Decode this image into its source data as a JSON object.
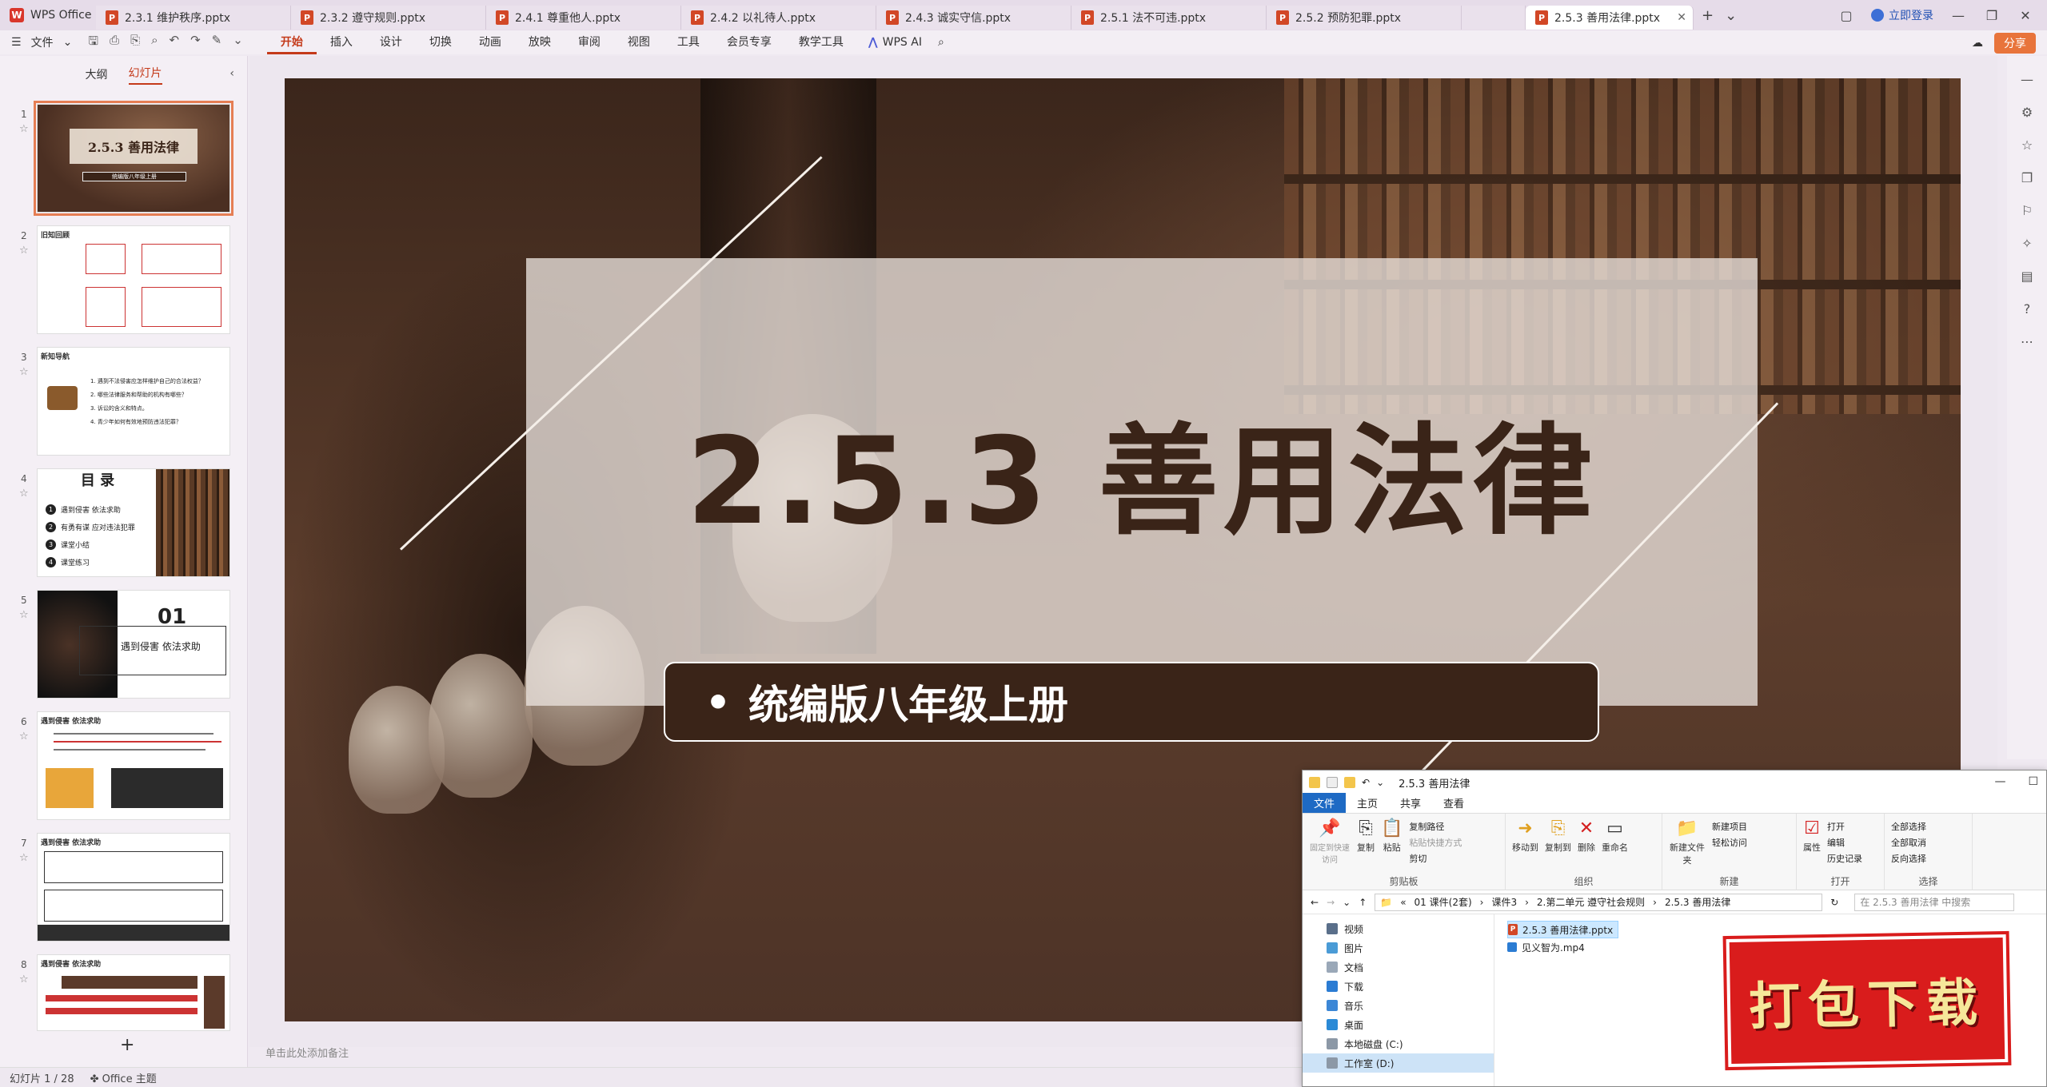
{
  "tabbar": {
    "app_name": "WPS Office",
    "tabs": [
      {
        "label": "2.3.1 维护秩序.pptx"
      },
      {
        "label": "2.3.2 遵守规则.pptx"
      },
      {
        "label": "2.4.1 尊重他人.pptx"
      },
      {
        "label": "2.4.2 以礼待人.pptx"
      },
      {
        "label": "2.4.3 诚实守信.pptx"
      },
      {
        "label": "2.5.1 法不可违.pptx"
      },
      {
        "label": "2.5.2 预防犯罪.pptx"
      },
      {
        "label": ""
      },
      {
        "label": "2.5.3 善用法律.pptx"
      }
    ],
    "login_label": "立即登录"
  },
  "menubar": {
    "file_label": "文件",
    "tabs": [
      "开始",
      "插入",
      "设计",
      "切换",
      "动画",
      "放映",
      "审阅",
      "视图",
      "工具",
      "会员专享",
      "教学工具"
    ],
    "active_tab": "开始",
    "ai_label": "WPS AI",
    "share_label": "分享"
  },
  "leftpanel": {
    "tabs": [
      "大纲",
      "幻灯片"
    ],
    "active_tab": "幻灯片",
    "thumbs": [
      {
        "num": "1",
        "title": "2.5.3 善用法律",
        "subtitle": "统编版八年级上册"
      },
      {
        "num": "2",
        "header": "旧知回顾"
      },
      {
        "num": "3",
        "header": "新知导航",
        "lines": [
          "1. 遇到不法侵害应怎样维护自己的合法权益？",
          "2. 哪些法律服务和帮助的机构有哪些？",
          "3. 诉讼的含义和特点。",
          "4. 青少年如何有效地预防违法犯罪？"
        ]
      },
      {
        "num": "4",
        "title": "目 录",
        "items": [
          "遇到侵害 依法求助",
          "有勇有谋 应对违法犯罪",
          "课堂小结",
          "课堂练习"
        ]
      },
      {
        "num": "5",
        "number": "01",
        "text": "遇到侵害 依法求助"
      },
      {
        "num": "6",
        "header": "遇到侵害 依法求助"
      },
      {
        "num": "7",
        "header": "遇到侵害 依法求助"
      },
      {
        "num": "8",
        "header": "遇到侵害 依法求助"
      }
    ]
  },
  "slide": {
    "title": "2.5.3 善用法律",
    "subtitle": "统编版八年级上册",
    "bullet": "•"
  },
  "notes_placeholder": "单击此处添加备注",
  "statusbar": {
    "slide_count": "幻灯片 1 / 28",
    "theme": "Office 主题"
  },
  "explorer": {
    "title": "2.5.3 善用法律",
    "ribbon_tabs": [
      "文件",
      "主页",
      "共享",
      "查看"
    ],
    "groups": [
      {
        "label": "剪贴板",
        "buttons": [
          "固定到快速访问",
          "复制",
          "粘贴"
        ],
        "small": [
          "复制路径",
          "粘贴快捷方式",
          "剪切"
        ]
      },
      {
        "label": "组织",
        "buttons": [
          "移动到",
          "复制到",
          "删除",
          "重命名"
        ]
      },
      {
        "label": "新建",
        "buttons": [
          "新建文件夹"
        ],
        "small": [
          "新建项目",
          "轻松访问"
        ]
      },
      {
        "label": "打开",
        "buttons": [
          "属性"
        ],
        "small": [
          "打开",
          "编辑",
          "历史记录"
        ]
      },
      {
        "label": "选择",
        "small": [
          "全部选择",
          "全部取消",
          "反向选择"
        ]
      }
    ],
    "breadcrumb": [
      "01 课件(2套)",
      "课件3",
      "2.第二单元 遵守社会规则",
      "2.5.3 善用法律"
    ],
    "search_placeholder": "在 2.5.3 善用法律 中搜索",
    "nav_items": [
      "视频",
      "图片",
      "文档",
      "下载",
      "音乐",
      "桌面",
      "本地磁盘 (C:)",
      "工作室 (D:)"
    ],
    "files": [
      "2.5.3 善用法律.pptx",
      "见义智为.mp4"
    ]
  },
  "promo": {
    "label": "打包下载"
  },
  "colors": {
    "accent": "#c43a1a",
    "slide_dark": "#3a2418",
    "promo_red": "#d91c1c"
  }
}
